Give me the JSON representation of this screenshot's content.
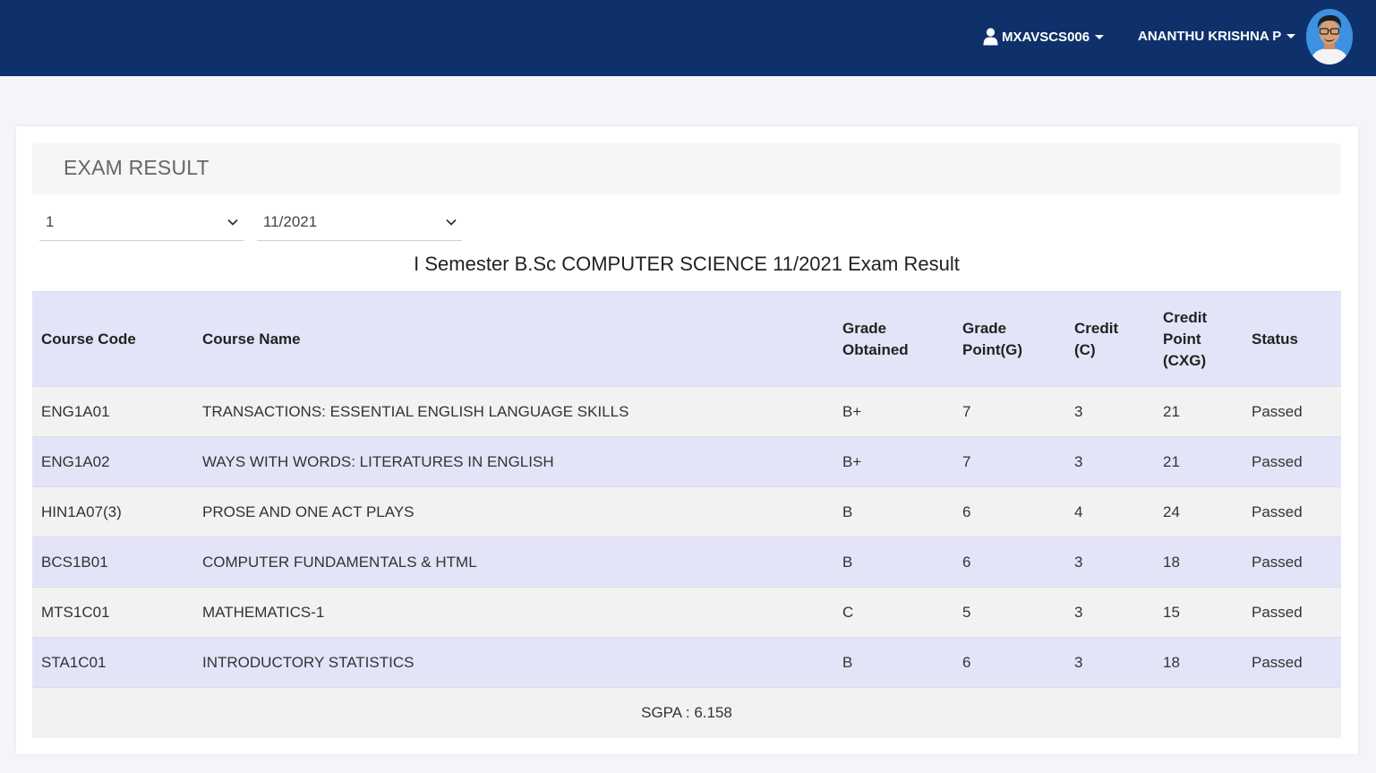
{
  "header": {
    "user_id": "MXAVSCS006",
    "user_name": "ANANTHU KRISHNA P",
    "colors": {
      "bar": "#0f316b",
      "text": "#ffffff"
    }
  },
  "card": {
    "title": "EXAM RESULT"
  },
  "filters": {
    "semester": "1",
    "exam_session": "11/2021"
  },
  "result_heading": "I Semester B.Sc COMPUTER SCIENCE 11/2021 Exam Result",
  "table": {
    "columns": {
      "course_code": "Course Code",
      "course_name": "Course Name",
      "grade_obtained": [
        "Grade",
        "Obtained"
      ],
      "grade_point": [
        "Grade",
        "Point(G)"
      ],
      "credit": [
        "Credit",
        "(C)"
      ],
      "credit_point": [
        "Credit",
        "Point",
        "(CXG)"
      ],
      "status": "Status"
    },
    "rows": [
      {
        "code": "ENG1A01",
        "name": "TRANSACTIONS: ESSENTIAL ENGLISH LANGUAGE SKILLS",
        "grade": "B+",
        "gp": "7",
        "credit": "3",
        "cp": "21",
        "status": "Passed"
      },
      {
        "code": "ENG1A02",
        "name": "WAYS WITH WORDS: LITERATURES IN ENGLISH",
        "grade": "B+",
        "gp": "7",
        "credit": "3",
        "cp": "21",
        "status": "Passed"
      },
      {
        "code": "HIN1A07(3)",
        "name": "PROSE AND ONE ACT PLAYS",
        "grade": "B",
        "gp": "6",
        "credit": "4",
        "cp": "24",
        "status": "Passed"
      },
      {
        "code": "BCS1B01",
        "name": "COMPUTER FUNDAMENTALS & HTML",
        "grade": "B",
        "gp": "6",
        "credit": "3",
        "cp": "18",
        "status": "Passed"
      },
      {
        "code": "MTS1C01",
        "name": "MATHEMATICS-1",
        "grade": "C",
        "gp": "5",
        "credit": "3",
        "cp": "15",
        "status": "Passed"
      },
      {
        "code": "STA1C01",
        "name": "INTRODUCTORY STATISTICS",
        "grade": "B",
        "gp": "6",
        "credit": "3",
        "cp": "18",
        "status": "Passed"
      }
    ],
    "footer": "SGPA : 6.158"
  }
}
